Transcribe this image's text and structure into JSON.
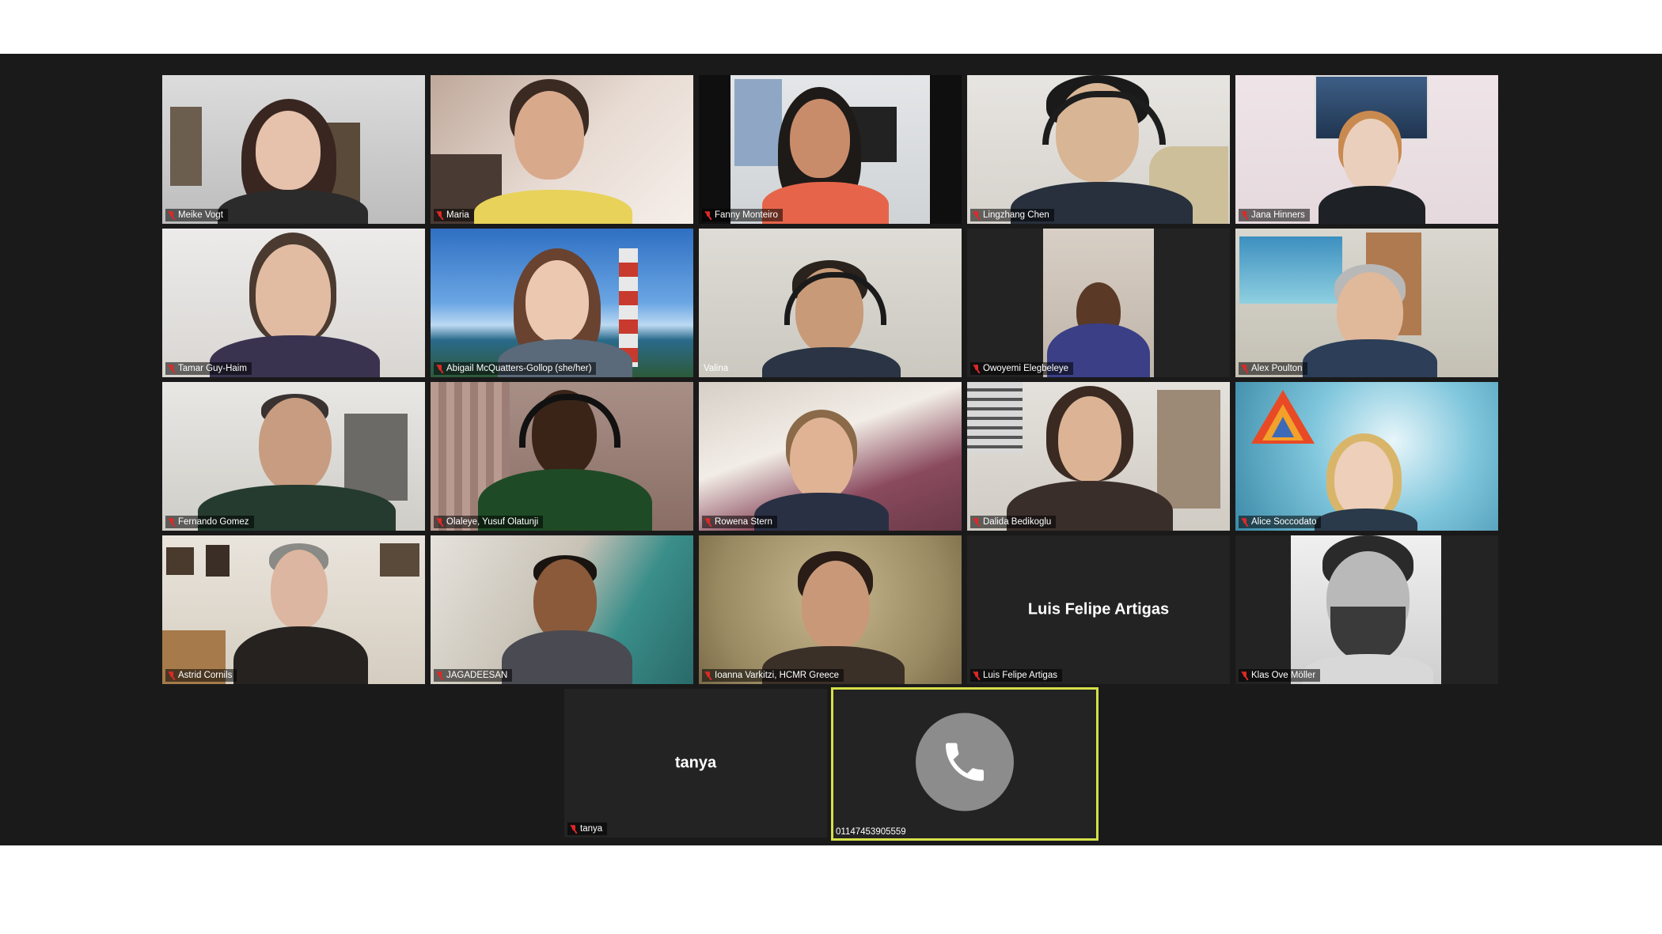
{
  "meeting": {
    "view": "gallery",
    "participants": [
      {
        "name": "Meike Vogt",
        "muted": true
      },
      {
        "name": "Maria",
        "muted": true
      },
      {
        "name": "Fanny Monteiro",
        "muted": true
      },
      {
        "name": "Lingzhang Chen",
        "muted": true
      },
      {
        "name": "Jana Hinners",
        "muted": true
      },
      {
        "name": "Tamar Guy-Haim",
        "muted": true
      },
      {
        "name": "Abigail McQuatters-Gollop (she/her)",
        "muted": true
      },
      {
        "name": "Valina",
        "muted": false
      },
      {
        "name": "Owoyemi Elegbeleye",
        "muted": true
      },
      {
        "name": "Alex Poulton",
        "muted": true
      },
      {
        "name": "Fernando Gomez",
        "muted": true
      },
      {
        "name": "Olaleye, Yusuf Olatunji",
        "muted": true
      },
      {
        "name": "Rowena Stern",
        "muted": true
      },
      {
        "name": "Dalida Bedikoglu",
        "muted": true
      },
      {
        "name": "Alice Soccodato",
        "muted": true
      },
      {
        "name": "Astrid Cornils",
        "muted": true
      },
      {
        "name": "JAGADEESAN",
        "muted": true
      },
      {
        "name": "Ioanna Varkitzi, HCMR Greece",
        "muted": true
      },
      {
        "name": "Luis Felipe Artigas",
        "muted": true,
        "display": "Luis Felipe Artigas"
      },
      {
        "name": "Klas Ove Möller",
        "muted": true
      },
      {
        "name": "tanya",
        "muted": true,
        "display": "tanya"
      },
      {
        "name": "01147453905559",
        "muted": false,
        "phone": true
      }
    ]
  },
  "colors": {
    "stage": "#1a1a1a",
    "tile": "#232323",
    "active_speaker_border": "#d5e04a",
    "muted_icon": "#e02828",
    "phone_circle": "#8c8c8c"
  },
  "icons": {
    "muted": "mic-muted-icon",
    "phone": "phone-icon"
  }
}
